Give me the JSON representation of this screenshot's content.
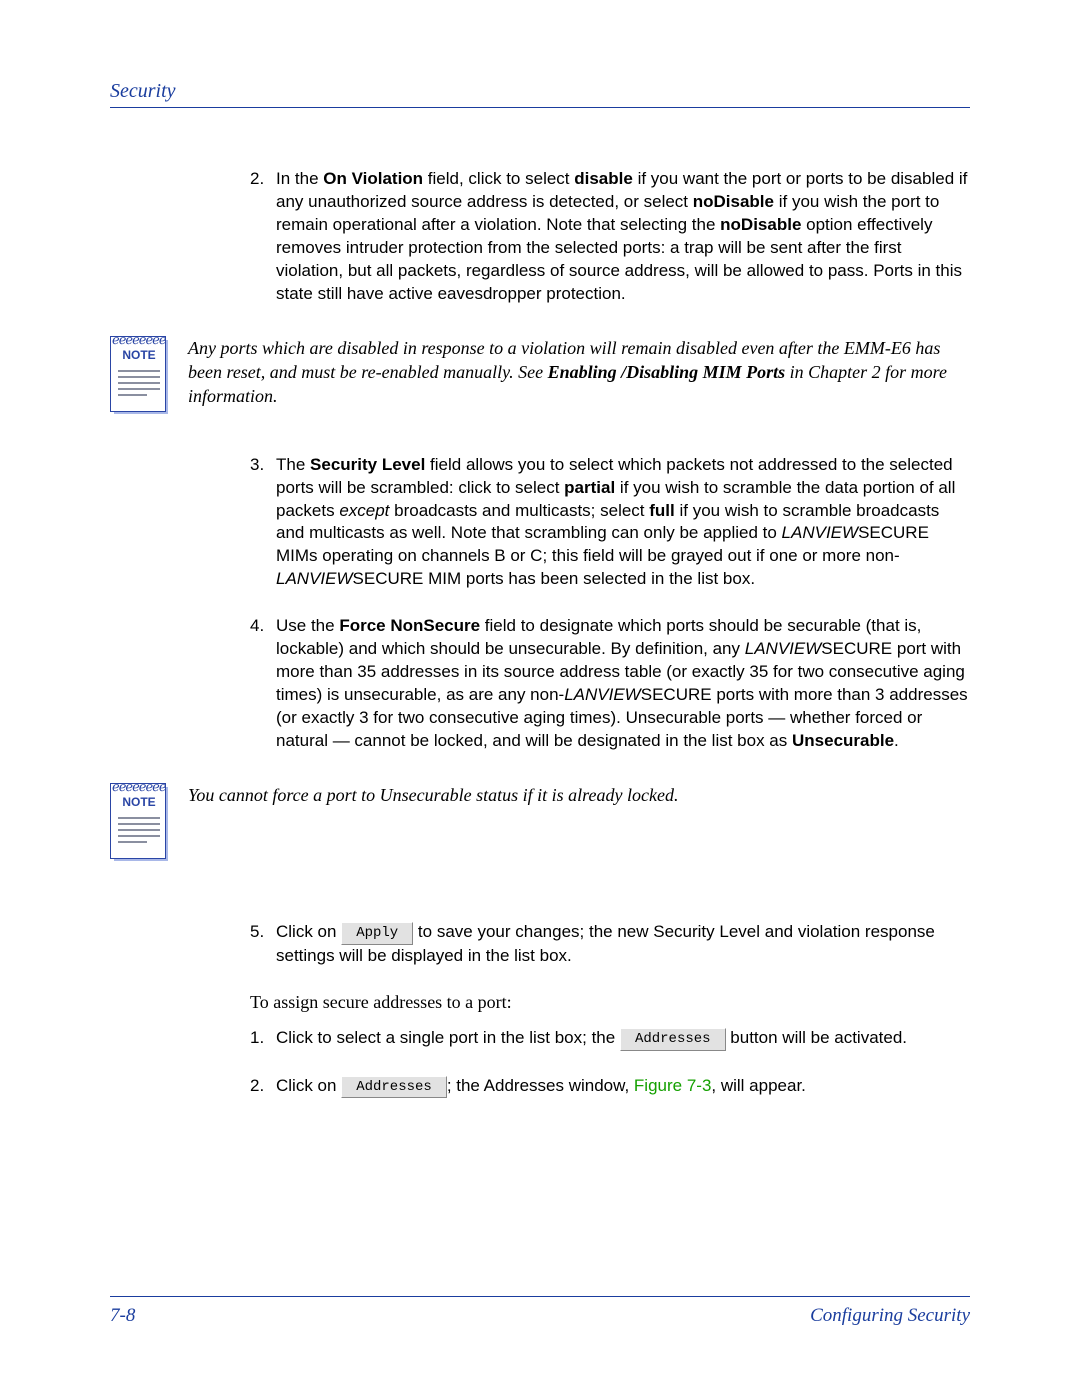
{
  "header": {
    "title": "Security"
  },
  "steps_a": [
    {
      "num": "2.",
      "html": "In the <b>On Violation</b> field, click to select <b>disable</b> if you want the port or ports to be disabled if any unauthorized source address is detected, or select <b>noDisable</b> if you wish the port to remain operational after a violation. Note that selecting the <b>noDisable</b> option effectively removes intruder protection from the selected ports: a trap will be sent after the first violation, but all packets, regardless of source address, will be allowed to pass. Ports in this state still have active eavesdropper protection."
    }
  ],
  "note1": {
    "label": "NOTE",
    "html": "Any ports which are disabled in response to a violation will remain disabled even after the EMM-E6 has been reset, and must be re-enabled manually. See <span class='upright'><b><i>Enabling /Disabling MIM Ports</i></b></span> in Chapter 2 for more information."
  },
  "steps_b": [
    {
      "num": "3.",
      "html": "The <b>Security Level</b> field allows you to select which packets not addressed to the selected ports will be scrambled: click to select <b>partial</b> if you wish to scramble the data portion of all packets <i>except</i> broadcasts and multicasts; select <b>full</b> if you wish to scramble broadcasts and multicasts as well. Note that scrambling can only be applied to <span class='lanview'>LANVIEW</span><span class='smallcaps'>SECURE</span> MIMs operating on channels B or C; this field will be grayed out if one or more non-<span class='lanview'>LANVIEW</span><span class='smallcaps'>SECURE</span> MIM ports has been selected in the list box."
    },
    {
      "num": "4.",
      "html": "Use the <b>Force NonSecure</b> field to designate which ports should be securable (that is, lockable) and which should be unsecurable. By definition, any <span class='lanview'>LANVIEW</span><span class='smallcaps'>SECURE</span> port with more than 35 addresses in its source address table (or exactly 35 for two consecutive aging times) is unsecurable, as are any non-<span class='lanview'>LANVIEW</span><span class='smallcaps'>SECURE</span> ports with more than 3 addresses (or exactly 3 for two consecutive aging times). Unsecurable ports — whether forced or natural — cannot be locked, and will be designated in the list box as <b>Unsecurable</b>."
    }
  ],
  "note2": {
    "label": "NOTE",
    "html": "You cannot force a port to Unsecurable status if it is already locked."
  },
  "steps_c": [
    {
      "num": "5.",
      "pre": "Click on ",
      "btn": "Apply",
      "post": " to save your changes; the new Security Level and violation response settings will be displayed in the list box."
    }
  ],
  "intro": "To assign secure addresses to a port:",
  "steps_d": [
    {
      "num": "1.",
      "pre": "Click to select a single port in the list box; the ",
      "btn": "Addresses",
      "post": " button will be activated."
    },
    {
      "num": "2.",
      "pre": "Click on ",
      "btn": "Addresses",
      "post_html": "; the Addresses window, <span class='figref'>Figure 7-3</span>, will appear."
    }
  ],
  "footer": {
    "page": "7-8",
    "section": "Configuring Security"
  }
}
